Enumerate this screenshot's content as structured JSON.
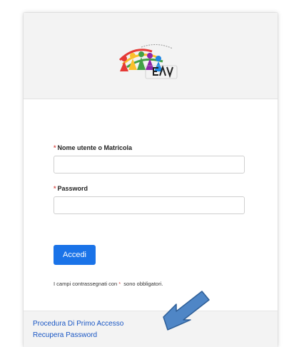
{
  "form": {
    "username_label": "Nome utente o Matricola",
    "password_label": "Password",
    "required_marker": "*",
    "username_value": "",
    "password_value": "",
    "submit_label": "Accedi",
    "note_prefix": "I campi contrassegnati con ",
    "note_marker": "*",
    "note_suffix": " sono obbligatori."
  },
  "footer": {
    "first_access_link": "Procedura Di Primo Accesso",
    "recover_password_link": "Recupera Password"
  },
  "logo": {
    "text": "EAV"
  },
  "colors": {
    "accent": "#1a73e8",
    "required": "#d9534f",
    "link": "#1a57c4",
    "arrow": "#4f86c6"
  },
  "icons": {
    "logo": "eav-logo",
    "pointer": "arrow-pointer-icon"
  }
}
